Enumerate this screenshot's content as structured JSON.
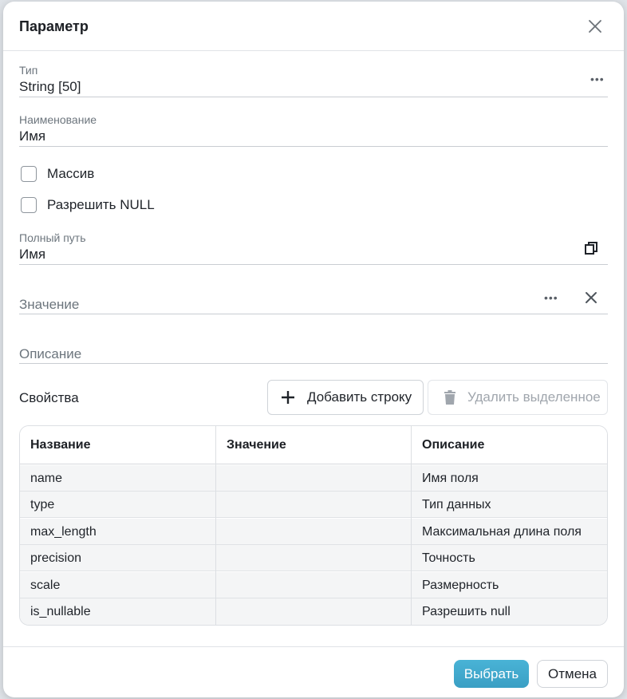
{
  "dialog": {
    "title": "Параметр"
  },
  "fields": {
    "type": {
      "label": "Тип",
      "value": "String [50]"
    },
    "name": {
      "label": "Наименование",
      "value": "Имя"
    },
    "full_path": {
      "label": "Полный путь",
      "value": "Имя"
    },
    "value": {
      "placeholder": "Значение"
    },
    "description": {
      "placeholder": "Описание"
    }
  },
  "checkboxes": [
    {
      "label": "Массив",
      "checked": false
    },
    {
      "label": "Разрешить NULL",
      "checked": false
    }
  ],
  "properties": {
    "label": "Свойства",
    "add_button": "Добавить строку",
    "delete_button": "Удалить выделенное",
    "columns": [
      "Название",
      "Значение",
      "Описание"
    ],
    "rows": [
      {
        "name": "name",
        "value": "",
        "description": "Имя поля"
      },
      {
        "name": "type",
        "value": "",
        "description": "Тип данных"
      },
      {
        "name": "max_length",
        "value": "",
        "description": "Максимальная длина поля"
      },
      {
        "name": "precision",
        "value": "",
        "description": "Точность"
      },
      {
        "name": "scale",
        "value": "",
        "description": "Размерность"
      },
      {
        "name": "is_nullable",
        "value": "",
        "description": "Разрешить null"
      }
    ]
  },
  "footer": {
    "ok_label": "Выбрать",
    "cancel_label": "Отмена"
  },
  "icons": {
    "close": "close-icon",
    "more": "more-dots-icon",
    "copy": "copy-icon",
    "plus": "plus-icon",
    "trash": "trash-icon"
  },
  "colors": {
    "primary": "#3a9fc4",
    "border": "#c9cdd2",
    "label": "#6c757d"
  }
}
